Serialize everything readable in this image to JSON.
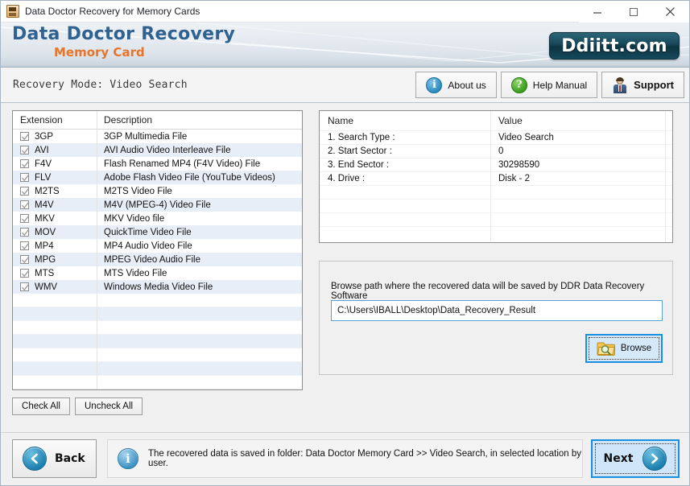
{
  "window": {
    "title": "Data Doctor Recovery for Memory Cards",
    "icon": "app-document-icon",
    "minimize": "minimize-icon",
    "maximize": "maximize-icon",
    "close": "close-icon"
  },
  "banner": {
    "brand_main": "Data Doctor Recovery",
    "brand_sub": "Memory Card",
    "logo_text": "Ddiitt.com",
    "logo_color": "#14465a",
    "brand_main_color": "#2f6191",
    "brand_sub_color": "#e8752a"
  },
  "modebar": {
    "mode_text": "Recovery Mode: Video Search",
    "buttons": [
      {
        "label": "About us",
        "icon": "info-icon",
        "color": "#2a8cc0"
      },
      {
        "label": "Help Manual",
        "icon": "question-icon",
        "color": "#3a9e1e"
      },
      {
        "label": "Support",
        "icon": "person-icon",
        "color": "#4a6d96"
      }
    ]
  },
  "extension_list": {
    "columns": [
      "Extension",
      "Description"
    ],
    "rows": [
      {
        "checked": true,
        "ext": "3GP",
        "desc": "3GP Multimedia File"
      },
      {
        "checked": true,
        "ext": "AVI",
        "desc": "AVI Audio Video Interleave File"
      },
      {
        "checked": true,
        "ext": "F4V",
        "desc": "Flash Renamed MP4 (F4V Video) File"
      },
      {
        "checked": true,
        "ext": "FLV",
        "desc": "Adobe Flash Video File (YouTube Videos)"
      },
      {
        "checked": true,
        "ext": "M2TS",
        "desc": "M2TS Video File"
      },
      {
        "checked": true,
        "ext": "M4V",
        "desc": "M4V (MPEG-4) Video File"
      },
      {
        "checked": true,
        "ext": "MKV",
        "desc": "MKV Video file"
      },
      {
        "checked": true,
        "ext": "MOV",
        "desc": "QuickTime Video File"
      },
      {
        "checked": true,
        "ext": "MP4",
        "desc": "MP4 Audio Video File"
      },
      {
        "checked": true,
        "ext": "MPG",
        "desc": "MPEG Video Audio File"
      },
      {
        "checked": true,
        "ext": "MTS",
        "desc": "MTS Video File"
      },
      {
        "checked": true,
        "ext": "WMV",
        "desc": "Windows Media Video File"
      }
    ],
    "empty_row_count": 7,
    "check_all_label": "Check All",
    "uncheck_all_label": "Uncheck All"
  },
  "info_table": {
    "columns": [
      "Name",
      "Value"
    ],
    "rows": [
      {
        "name": "1. Search Type :",
        "value": "Video Search"
      },
      {
        "name": "2. Start Sector :",
        "value": "0"
      },
      {
        "name": "3. End Sector :",
        "value": "30298590"
      },
      {
        "name": "4. Drive :",
        "value": "Disk - 2"
      }
    ],
    "empty_row_count": 4
  },
  "browse": {
    "instruction": "Browse path where the recovered data will be saved by DDR Data Recovery Software",
    "path_value": "C:\\Users\\IBALL\\Desktop\\Data_Recovery_Result",
    "path_placeholder": "",
    "button_label": "Browse",
    "button_icon": "folder-search-icon",
    "focus_color": "#1a8fe0"
  },
  "bottom": {
    "back_label": "Back",
    "back_icon": "chevron-left-circle-icon",
    "status_icon": "info-icon",
    "status_text": "The recovered data is saved in folder: Data Doctor Memory Card  >> Video Search, in selected location by user.",
    "next_label": "Next",
    "next_icon": "chevron-right-circle-icon",
    "next_accent": "#1a8fe0"
  }
}
